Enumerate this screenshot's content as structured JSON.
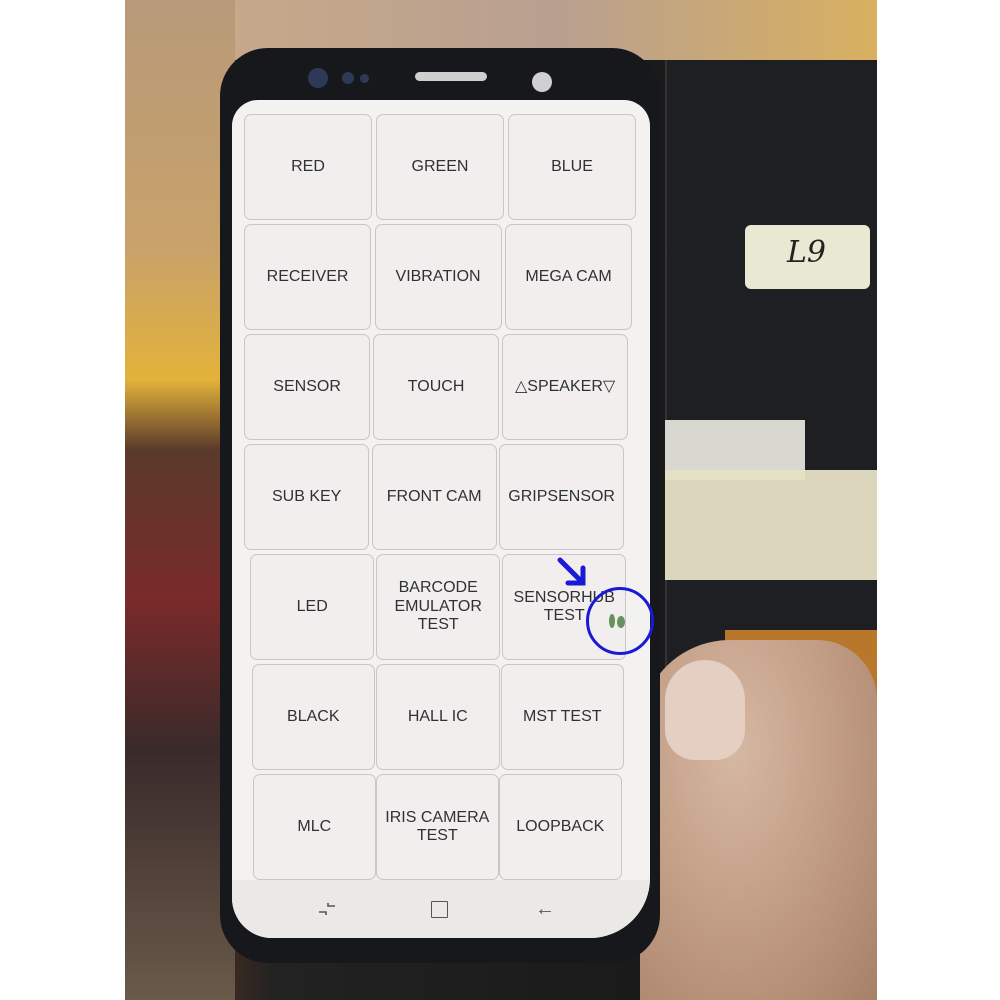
{
  "test_menu": {
    "rows": [
      [
        "RED",
        "GREEN",
        "BLUE"
      ],
      [
        "RECEIVER",
        "VIBRATION",
        "MEGA CAM"
      ],
      [
        "SENSOR",
        "TOUCH",
        "△SPEAKER▽"
      ],
      [
        "SUB KEY",
        "FRONT CAM",
        "GRIPSENSOR"
      ],
      [
        "LED",
        "BARCODE\nEMULATOR TEST",
        "SENSORHUB\nTEST"
      ],
      [
        "BLACK",
        "HALL IC",
        "MST TEST"
      ],
      [
        "MLC",
        "IRIS CAMERA\nTEST",
        "LOOPBACK"
      ]
    ]
  },
  "navbar": {
    "recents": "recents-icon",
    "home": "home-icon",
    "back": "back-icon",
    "back_glyph": "←"
  },
  "background": {
    "sticker_text": "L9"
  },
  "annotation": {
    "color": "#1a1ad6",
    "target": "SENSORHUB TEST",
    "marker_color": "#3f7a3a"
  }
}
